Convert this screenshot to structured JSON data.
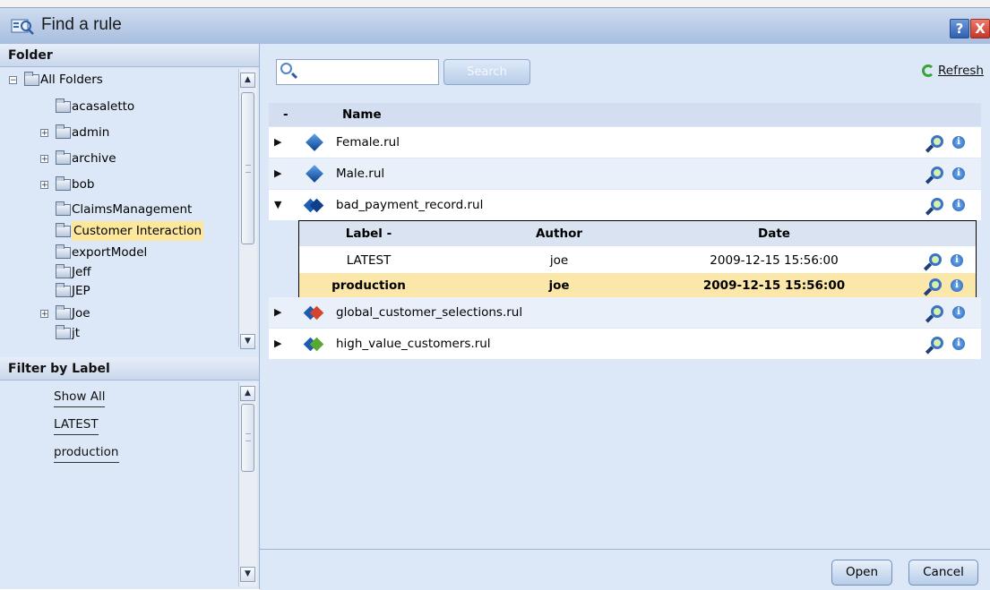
{
  "window": {
    "title": "Find a rule",
    "help_label": "?",
    "close_label": "X"
  },
  "folder_panel": {
    "heading": "Folder",
    "items": [
      {
        "label": "All Folders",
        "toggle": "−",
        "level": 0
      },
      {
        "label": "acasaletto",
        "toggle": "",
        "level": 1
      },
      {
        "label": "admin",
        "toggle": "+",
        "level": 1
      },
      {
        "label": "archive",
        "toggle": "+",
        "level": 1
      },
      {
        "label": "bob",
        "toggle": "+",
        "level": 1
      },
      {
        "label": "ClaimsManagement",
        "toggle": "",
        "level": 1
      },
      {
        "label": "Customer Interaction",
        "toggle": "",
        "level": 1,
        "selected": true
      },
      {
        "label": "exportModel",
        "toggle": "",
        "level": 1
      },
      {
        "label": "Jeff",
        "toggle": "",
        "level": 1
      },
      {
        "label": "JEP",
        "toggle": "",
        "level": 1
      },
      {
        "label": "Joe",
        "toggle": "+",
        "level": 1
      },
      {
        "label": "jt",
        "toggle": "",
        "level": 1
      }
    ]
  },
  "label_panel": {
    "heading": "Filter by Label",
    "items": [
      "Show All",
      "LATEST",
      "production"
    ]
  },
  "search": {
    "placeholder": "",
    "value": "",
    "button_label": "Search"
  },
  "refresh_label": "Refresh",
  "list": {
    "sort_marker": "-",
    "column_name": "Name",
    "rules": [
      {
        "name": "Female.rul",
        "expanded": false
      },
      {
        "name": "Male.rul",
        "expanded": false
      },
      {
        "name": "bad_payment_record.rul",
        "expanded": true
      },
      {
        "name": "global_customer_selections.rul",
        "expanded": false
      },
      {
        "name": "high_value_customers.rul",
        "expanded": false
      }
    ],
    "versions": {
      "headers": {
        "label": "Label -",
        "author": "Author",
        "date": "Date"
      },
      "rows": [
        {
          "label": "LATEST",
          "author": "joe",
          "date": "2009-12-15 15:56:00",
          "highlighted": false
        },
        {
          "label": "production",
          "author": "joe",
          "date": "2009-12-15 15:56:00",
          "highlighted": true
        }
      ]
    }
  },
  "footer": {
    "open_label": "Open",
    "cancel_label": "Cancel"
  },
  "colors": {
    "panel_bg": "#dce8f7",
    "selection": "#fde79d",
    "row_highlight": "#fbe7a9",
    "accent_blue": "#2f5fb0"
  }
}
